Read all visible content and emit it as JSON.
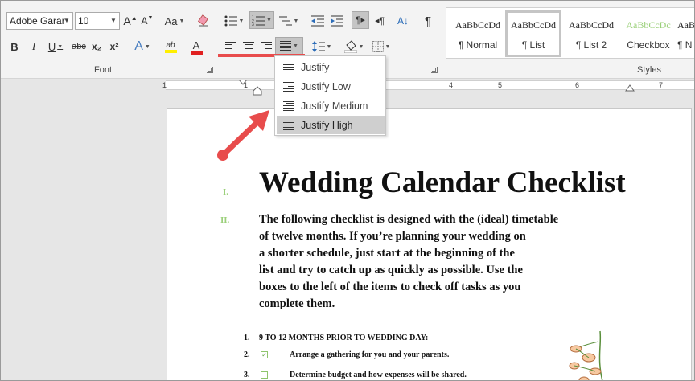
{
  "font": {
    "name_value": "Adobe Garar",
    "size_value": "10",
    "group_label": "Font",
    "grow_label": "A",
    "shrink_label": "A",
    "case_label": "Aa",
    "bold_label": "B",
    "italic_label": "I",
    "underline_label": "U",
    "strike_label": "abc",
    "subscript_label": "x₂",
    "superscript_label": "x²",
    "effects_label": "A",
    "highlight_label": "ab",
    "color_label": "A",
    "highlight_color": "#ffef00",
    "font_color": "#e02020"
  },
  "paragraph": {
    "ltr_label": "¶",
    "rtl_label": "¶",
    "sort_label": "A↓",
    "show_marks_label": "¶"
  },
  "styles": {
    "group_label": "Styles",
    "tiles": [
      {
        "sample": "AaBbCcDd",
        "name": "¶ Normal",
        "color": "#222222"
      },
      {
        "sample": "AaBbCcDd",
        "name": "¶ List",
        "color": "#222222"
      },
      {
        "sample": "AaBbCcDd",
        "name": "¶ List 2",
        "color": "#222222"
      },
      {
        "sample": "AaBbCcDc",
        "name": "Checkbox",
        "color": "#9bd07a"
      },
      {
        "sample": "AaBb",
        "name": "¶ N",
        "color": "#222222"
      }
    ]
  },
  "ruler": {
    "numbers": [
      "1",
      "1",
      "2",
      "3",
      "4",
      "5",
      "6",
      "7"
    ]
  },
  "justify_menu": {
    "items": [
      {
        "label": "Justify",
        "highlighted": false
      },
      {
        "label": "Justify Low",
        "highlighted": false
      },
      {
        "label": "Justify Medium",
        "highlighted": false
      },
      {
        "label": "Justify High",
        "highlighted": true
      }
    ]
  },
  "document": {
    "roman_1": "I.",
    "roman_2": "II.",
    "title": "Wedding Calendar Checklist",
    "intro_lines": [
      "The following checklist is designed with the (ideal) timetable",
      "of twelve months. If you’re planning your wedding on",
      "a shorter schedule, just start at the beginning of the",
      "list and try to catch up as quickly as possible. Use the",
      "boxes to the left of the items to check off tasks as you",
      "complete them."
    ],
    "list": [
      {
        "num": "1.",
        "text": "9 TO 12 MONTHS PRIOR TO WEDDING DAY:",
        "checkbox": null
      },
      {
        "num": "2.",
        "text": "Arrange a gathering for you and your parents.",
        "checkbox": "checked"
      },
      {
        "num": "3.",
        "text": "Determine budget and how expenses will be shared.",
        "checkbox": "unchecked"
      }
    ]
  },
  "colors": {
    "accent_red": "#e84c4c",
    "list_green": "#9bd07a"
  }
}
